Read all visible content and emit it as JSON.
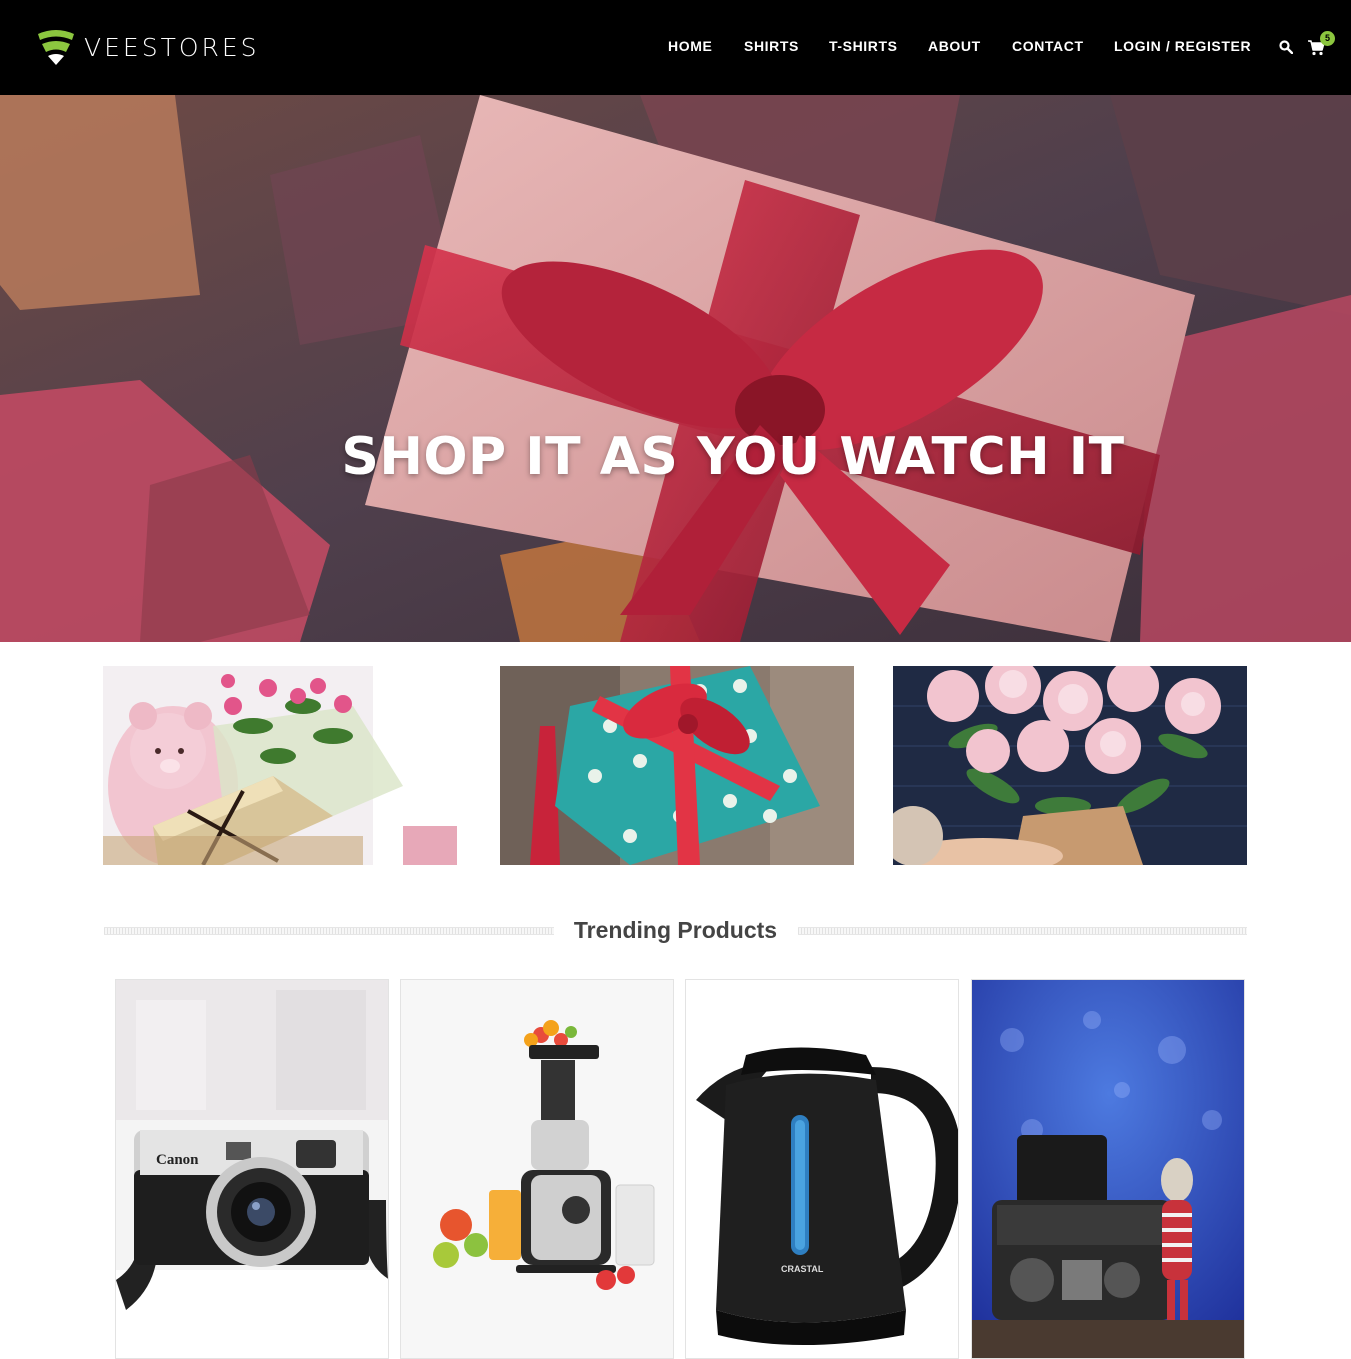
{
  "brand": {
    "name": "VEESTORES",
    "accent_color": "#8cc63f"
  },
  "nav": {
    "items": [
      {
        "label": "HOME"
      },
      {
        "label": "SHIRTS"
      },
      {
        "label": "T-SHIRTS"
      },
      {
        "label": "ABOUT"
      },
      {
        "label": "CONTACT"
      },
      {
        "label": "LOGIN / REGISTER"
      }
    ],
    "search_icon": "search-icon",
    "cart_icon": "shopping-cart-icon",
    "cart_count": "5"
  },
  "hero": {
    "title": "SHOP IT AS YOU WATCH IT"
  },
  "categories": [
    {
      "image": "teddy-bear-roses-gift-basket"
    },
    {
      "image": "polka-dot-gift-box"
    },
    {
      "image": "peony-bouquet"
    }
  ],
  "trending": {
    "title": "Trending Products",
    "products": [
      {
        "image": "canon-film-camera",
        "brand_text": "Canon"
      },
      {
        "image": "slow-juicer-with-fruit"
      },
      {
        "image": "black-electric-kettle",
        "brand_text": "CRASTAL"
      },
      {
        "image": "mirrorless-camera-with-toy"
      }
    ]
  }
}
